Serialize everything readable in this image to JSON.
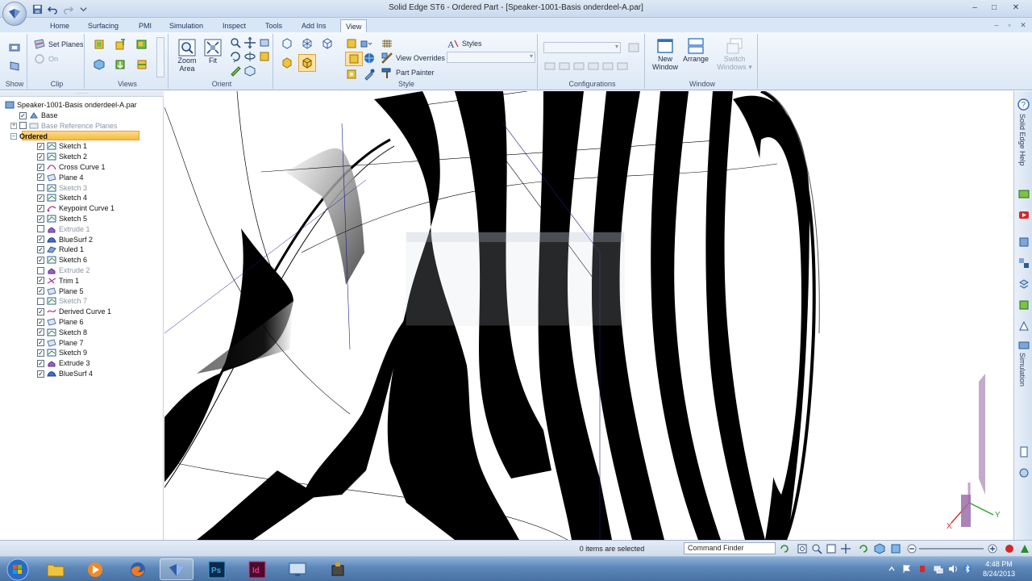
{
  "window": {
    "title": "Solid Edge ST6 - Ordered Part - [Speaker-1001-Basis onderdeel-A.par]",
    "controls": {
      "minimize": "–",
      "maximize": "□",
      "close": "✕"
    }
  },
  "ribbon_tabs": [
    "Home",
    "Surfacing",
    "PMI",
    "Simulation",
    "Inspect",
    "Tools",
    "Add Ins",
    "View"
  ],
  "active_tab": "View",
  "ribbon": {
    "show": {
      "label": "Show"
    },
    "clip": {
      "label": "Clip",
      "set_planes": "Set Planes",
      "on": "On"
    },
    "views": {
      "label": "Views"
    },
    "orient": {
      "label": "Orient",
      "zoom_area": "Zoom\nArea",
      "fit": "Fit"
    },
    "style": {
      "label": "Style",
      "styles": "Styles",
      "view_overrides": "View Overrides",
      "part_painter": "Part Painter"
    },
    "configurations": {
      "label": "Configurations"
    },
    "window_group": {
      "label": "Window",
      "new_window": "New\nWindow",
      "arrange": "Arrange",
      "switch_windows": "Switch\nWindows ▾"
    }
  },
  "pathfinder": {
    "root": "Speaker-1001-Basis onderdeel-A.par",
    "items": [
      {
        "label": "Base",
        "checked": true,
        "indent": 1,
        "icon": "coordinate-system-icon",
        "disabled": false
      },
      {
        "label": "Base Reference Planes",
        "checked": false,
        "indent": 1,
        "icon": "planes-icon",
        "disabled": true,
        "expander": "+"
      },
      {
        "label": "Ordered",
        "checked": null,
        "indent": 1,
        "icon": "",
        "disabled": false,
        "expander": "–",
        "highlight": true
      },
      {
        "label": "Sketch 1",
        "checked": true,
        "indent": 2,
        "icon": "sketch-icon",
        "disabled": false
      },
      {
        "label": "Sketch 2",
        "checked": true,
        "indent": 2,
        "icon": "sketch-icon",
        "disabled": false
      },
      {
        "label": "Cross Curve 1",
        "checked": true,
        "indent": 2,
        "icon": "cross-curve-icon",
        "disabled": false
      },
      {
        "label": "Plane 4",
        "checked": true,
        "indent": 2,
        "icon": "plane-icon",
        "disabled": false
      },
      {
        "label": "Sketch 3",
        "checked": false,
        "indent": 2,
        "icon": "sketch-icon",
        "disabled": true
      },
      {
        "label": "Sketch 4",
        "checked": true,
        "indent": 2,
        "icon": "sketch-icon",
        "disabled": false
      },
      {
        "label": "Keypoint Curve 1",
        "checked": true,
        "indent": 2,
        "icon": "keypoint-curve-icon",
        "disabled": false
      },
      {
        "label": "Sketch 5",
        "checked": true,
        "indent": 2,
        "icon": "sketch-icon",
        "disabled": false
      },
      {
        "label": "Extrude 1",
        "checked": false,
        "indent": 2,
        "icon": "extrude-icon",
        "disabled": true
      },
      {
        "label": "BlueSurf 2",
        "checked": true,
        "indent": 2,
        "icon": "bluesurf-icon",
        "disabled": false
      },
      {
        "label": "Ruled 1",
        "checked": true,
        "indent": 2,
        "icon": "ruled-icon",
        "disabled": false
      },
      {
        "label": "Sketch 6",
        "checked": true,
        "indent": 2,
        "icon": "sketch-icon",
        "disabled": false
      },
      {
        "label": "Extrude 2",
        "checked": false,
        "indent": 2,
        "icon": "extrude-icon",
        "disabled": true
      },
      {
        "label": "Trim 1",
        "checked": true,
        "indent": 2,
        "icon": "trim-icon",
        "disabled": false
      },
      {
        "label": "Plane 5",
        "checked": true,
        "indent": 2,
        "icon": "plane-icon",
        "disabled": false
      },
      {
        "label": "Sketch 7",
        "checked": false,
        "indent": 2,
        "icon": "sketch-icon",
        "disabled": true
      },
      {
        "label": "Derived Curve 1",
        "checked": true,
        "indent": 2,
        "icon": "derived-curve-icon",
        "disabled": false
      },
      {
        "label": "Plane 6",
        "checked": true,
        "indent": 2,
        "icon": "plane-icon",
        "disabled": false
      },
      {
        "label": "Sketch 8",
        "checked": true,
        "indent": 2,
        "icon": "sketch-icon",
        "disabled": false
      },
      {
        "label": "Plane 7",
        "checked": true,
        "indent": 2,
        "icon": "plane-icon",
        "disabled": false
      },
      {
        "label": "Sketch 9",
        "checked": true,
        "indent": 2,
        "icon": "sketch-icon",
        "disabled": false
      },
      {
        "label": "Extrude 3",
        "checked": true,
        "indent": 2,
        "icon": "extrude-icon",
        "disabled": false
      },
      {
        "label": "BlueSurf 4",
        "checked": true,
        "indent": 2,
        "icon": "bluesurf-icon",
        "disabled": false
      }
    ]
  },
  "right_rail": {
    "help_label": "Solid Edge Help",
    "simulation_label": "Simulation"
  },
  "status": {
    "selection": "0 items are selected",
    "command_finder": "Command Finder"
  },
  "taskbar": {
    "apps": [
      "explorer-icon",
      "media-player-icon",
      "firefox-icon",
      "solid-edge-icon",
      "photoshop-icon",
      "indesign-icon",
      "monitor-icon",
      "tool-icon"
    ],
    "time": "4:48 PM",
    "date": "8/24/2013"
  },
  "colors": {
    "accent": "#f5bb3c",
    "ribbon_bg": "#dce8f6",
    "taskbar": "#5c86b8"
  }
}
